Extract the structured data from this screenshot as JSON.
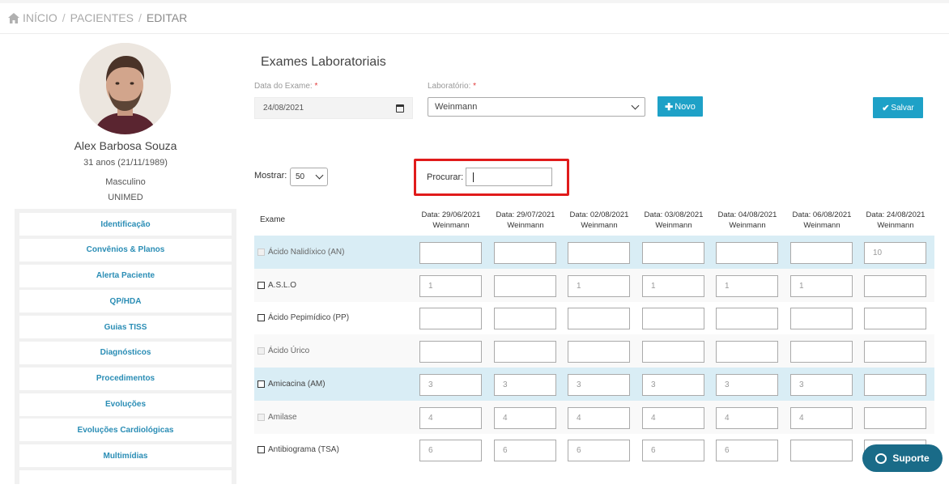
{
  "breadcrumb": {
    "home": "INÍCIO",
    "patients": "PACIENTES",
    "current": "EDITAR",
    "sep": "/"
  },
  "patient": {
    "name": "Alex Barbosa Souza",
    "age": "31 anos (21/11/1989)",
    "sex": "Masculino",
    "plan": "UNIMED"
  },
  "sidebar": {
    "items": [
      {
        "label": "Identificação"
      },
      {
        "label": "Convênios & Planos"
      },
      {
        "label": "Alerta Paciente"
      },
      {
        "label": "QP/HDA"
      },
      {
        "label": "Guias TISS"
      },
      {
        "label": "Diagnósticos"
      },
      {
        "label": "Procedimentos"
      },
      {
        "label": "Evoluções"
      },
      {
        "label": "Evoluções Cardiológicas"
      },
      {
        "label": "Multimídias"
      }
    ]
  },
  "main": {
    "title": "Exames Laboratoriais",
    "date_label": "Data do Exame:",
    "date_value": "24/08/2021",
    "lab_label": "Laboratório:",
    "lab_value": "Weinmann",
    "required": "*",
    "novo_button": "Novo",
    "salvar_button": "Salvar",
    "mostrar_label": "Mostrar:",
    "mostrar_value": "50",
    "procurar_label": "Procurar:",
    "procurar_value": ""
  },
  "table": {
    "exam_header": "Exame",
    "columns": [
      {
        "date": "Data: 29/06/2021",
        "lab": "Weinmann"
      },
      {
        "date": "Data: 29/07/2021",
        "lab": "Weinmann"
      },
      {
        "date": "Data: 02/08/2021",
        "lab": "Weinmann"
      },
      {
        "date": "Data: 03/08/2021",
        "lab": "Weinmann"
      },
      {
        "date": "Data: 04/08/2021",
        "lab": "Weinmann"
      },
      {
        "date": "Data: 06/08/2021",
        "lab": "Weinmann"
      },
      {
        "date": "Data: 24/08/2021",
        "lab": "Weinmann"
      }
    ],
    "rows": [
      {
        "name": "Ácido Nalidíxico (AN)",
        "checkbox_enabled": false,
        "highlight": true,
        "values": [
          "",
          "",
          "",
          "",
          "",
          "",
          "10"
        ]
      },
      {
        "name": "A.S.L.O",
        "checkbox_enabled": true,
        "highlight": false,
        "values": [
          "1",
          "",
          "1",
          "1",
          "1",
          "1",
          ""
        ]
      },
      {
        "name": "Ácido Pepimídico (PP)",
        "checkbox_enabled": true,
        "highlight": false,
        "values": [
          "",
          "",
          "",
          "",
          "",
          "",
          ""
        ]
      },
      {
        "name": "Ácido Úrico",
        "checkbox_enabled": false,
        "highlight": false,
        "values": [
          "",
          "",
          "",
          "",
          "",
          "",
          ""
        ]
      },
      {
        "name": "Amicacina (AM)",
        "checkbox_enabled": true,
        "highlight": true,
        "values": [
          "3",
          "3",
          "3",
          "3",
          "3",
          "3",
          ""
        ]
      },
      {
        "name": "Amilase",
        "checkbox_enabled": false,
        "highlight": false,
        "values": [
          "4",
          "4",
          "4",
          "4",
          "4",
          "4",
          ""
        ]
      },
      {
        "name": "Antibiograma (TSA)",
        "checkbox_enabled": true,
        "highlight": false,
        "values": [
          "6",
          "6",
          "6",
          "6",
          "6",
          "",
          ""
        ]
      }
    ]
  },
  "support": {
    "label": "Suporte"
  },
  "colors": {
    "accent": "#1ea1c7",
    "highlight_row": "#d9edf5",
    "focus_border": "#e01b1b",
    "support_bg": "#1a6b88"
  }
}
